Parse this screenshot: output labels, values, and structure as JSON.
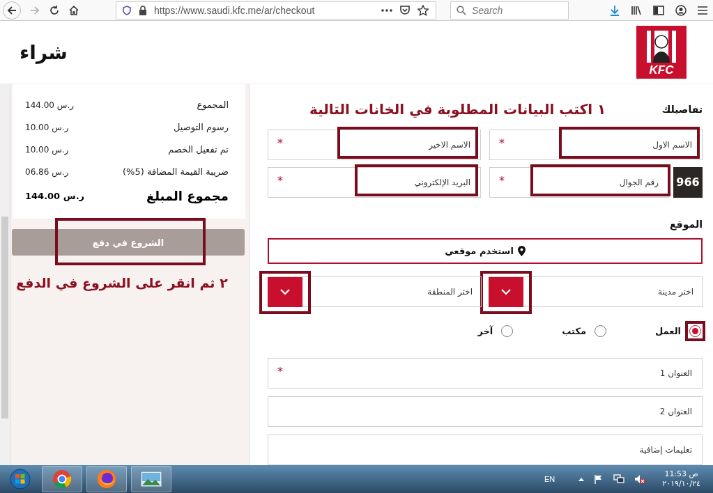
{
  "browser": {
    "url": "https://www.saudi.kfc.me/ar/checkout",
    "search_placeholder": "Search"
  },
  "header": {
    "title": "شراء",
    "logo_text": "KFC"
  },
  "summary": {
    "rows": [
      {
        "label": "المجموع",
        "value": "144.00 ر.س"
      },
      {
        "label": "رسوم التوصيل",
        "value": "10.00 ر.س"
      },
      {
        "label": "تم تفعيل الخصم",
        "value": "10.00 ر.س"
      },
      {
        "label": "ضريبة القيمة المضافة (5%)",
        "value": "06.86 ر.س"
      }
    ],
    "total": {
      "label": "مجموع المبلغ",
      "value": "144.00 ر.س"
    },
    "button": {
      "label": "الشروع في دفع",
      "disabled": true,
      "highlighted": true
    }
  },
  "annotations": [
    {
      "text": "١ اكتب البيانات المطلوبة في الخانات التالية"
    },
    {
      "text": "٢ ثم انقر على الشروع في الدفع"
    }
  ],
  "details": {
    "heading": "تفاصيلك",
    "country_code": "966",
    "fields": [
      {
        "placeholder": "الاسم الاول",
        "required_mark": "*",
        "highlighted": true
      },
      {
        "placeholder": "الاسم الاخير",
        "required_mark": "*",
        "highlighted": true
      },
      {
        "placeholder": "رقم الجوال",
        "required_mark": "*",
        "highlighted": true
      },
      {
        "placeholder": "البريد الإلكتروني",
        "required_mark": "*",
        "highlighted": true
      }
    ]
  },
  "location": {
    "heading": "الموقع",
    "use_location_button": "استخدم موقعي",
    "selects": [
      {
        "placeholder": "اختر مدينة",
        "highlighted": true
      },
      {
        "placeholder": "اختر المنطقة",
        "highlighted": true
      }
    ],
    "address_types": [
      {
        "label": "العمل",
        "selected": true,
        "highlighted": true
      },
      {
        "label": "مكتب",
        "selected": false,
        "highlighted": false
      },
      {
        "label": "آخر",
        "selected": false,
        "highlighted": false
      }
    ],
    "address_fields": [
      {
        "placeholder": "العنوان 1",
        "required_mark": "*"
      },
      {
        "placeholder": "العنوان 2"
      },
      {
        "placeholder": "تعليمات إضافية"
      }
    ]
  },
  "taskbar": {
    "language": "EN",
    "time": "11:53 ص",
    "date": "٢٠١٩/١٠/٢٤"
  }
}
